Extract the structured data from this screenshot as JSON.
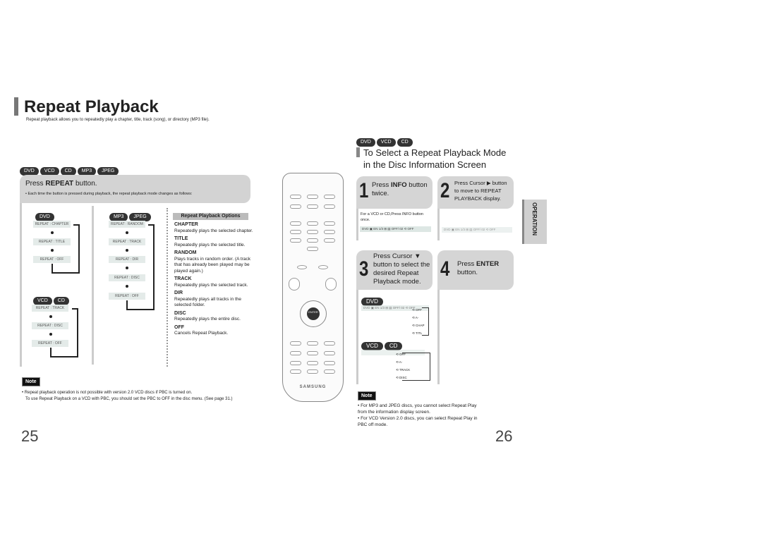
{
  "left": {
    "title": "Repeat Playback",
    "subtitle": "Repeat playback allows you to repeatedly play a chapter, title, track (song), or directory (MP3 file).",
    "badges": [
      "DVD",
      "VCD",
      "CD",
      "MP3",
      "JPEG"
    ],
    "instruction": {
      "prefix": "Press ",
      "bold": "REPEAT",
      "suffix": " button."
    },
    "bullet": "• Each time the button is pressed during playback, the repeat playback mode changes as follows:",
    "dvd_flow": {
      "badges": [
        "DVD"
      ],
      "items": [
        "REPEAT : CHAPTER",
        "REPEAT : TITLE",
        "REPEAT : OFF"
      ]
    },
    "vcd_flow": {
      "badges": [
        "VCD",
        "CD"
      ],
      "items": [
        "REPEAT : TRACK",
        "REPEAT : DISC",
        "REPEAT : OFF"
      ]
    },
    "mp3_flow": {
      "badges": [
        "MP3",
        "JPEG"
      ],
      "items": [
        "REPEAT : RANDOM",
        "REPEAT : TRACK",
        "REPEAT : DIR",
        "REPEAT : DISC",
        "REPEAT : OFF"
      ]
    },
    "options_title": "Repeat Playback Options",
    "options": [
      {
        "name": "CHAPTER",
        "desc": "Repeatedly plays the selected chapter."
      },
      {
        "name": "TITLE",
        "desc": "Repeatedly plays the selected title."
      },
      {
        "name": "RANDOM",
        "desc": "Plays tracks in random order. (A track that has already been played may be played again.)"
      },
      {
        "name": "TRACK",
        "desc": "Repeatedly plays the selected track."
      },
      {
        "name": "DIR",
        "desc": "Repeatedly plays all tracks in the selected folder."
      },
      {
        "name": "DISC",
        "desc": "Repeatedly plays the entire disc."
      },
      {
        "name": "OFF",
        "desc": "Cancels Repeat Playback."
      }
    ],
    "note_label": "Note",
    "note_lines": [
      "• Repeat playback operation is not possible with version 2.0 VCD discs if PBC is turned on.",
      "To use Repeat Playback on a VCD with PBC, you should set the PBC to OFF in the disc menu. (See page 31.)"
    ],
    "page_number": "25"
  },
  "remote": {
    "brand": "SAMSUNG",
    "enter": "ENTER"
  },
  "right": {
    "badges": [
      "DVD",
      "VCD",
      "CD"
    ],
    "heading": [
      "To Select a Repeat Playback Mode",
      "in the Disc Information Screen"
    ],
    "steps": [
      {
        "num": "1",
        "text_pre": "Press ",
        "bold": "INFO",
        "text_post": " button twice.",
        "sub": "For a VCD or CD,Press INFO button once."
      },
      {
        "num": "2",
        "text_pre": "Press Cursor ▶ button to move to REPEAT PLAYBACK display.",
        "bold": "",
        "text_post": ""
      },
      {
        "num": "3",
        "text_pre": "Press Cursor ▼ button to select the desired Repeat Playback mode.",
        "bold": "",
        "text_post": ""
      },
      {
        "num": "4",
        "text_pre": "Press ",
        "bold": "ENTER",
        "text_post": " button."
      }
    ],
    "display_bar": "DVD  ▣ EN 1/3  ⊞  ▤ OFF/ 02   ⟲ OFF",
    "dvd_badge": "DVD",
    "dvd_modes": [
      "⟲ OFF",
      "⟲ A-",
      "⟲ CHAP",
      "⟲ TITL"
    ],
    "vcd_badges": [
      "VCD",
      "CD"
    ],
    "vcd_modes": [
      "⟲ OFF",
      "⟲ A-",
      "⟲ TRACK",
      "⟲ DISC"
    ],
    "side_tab": "OPERATION",
    "note_label": "Note",
    "note_lines": [
      "• For MP3 and JPEG discs, you cannot select Repeat Play from the information display screen.",
      "• For VCD Version 2.0 discs, you can select Repeat Play in PBC off mode."
    ],
    "page_number": "26"
  }
}
